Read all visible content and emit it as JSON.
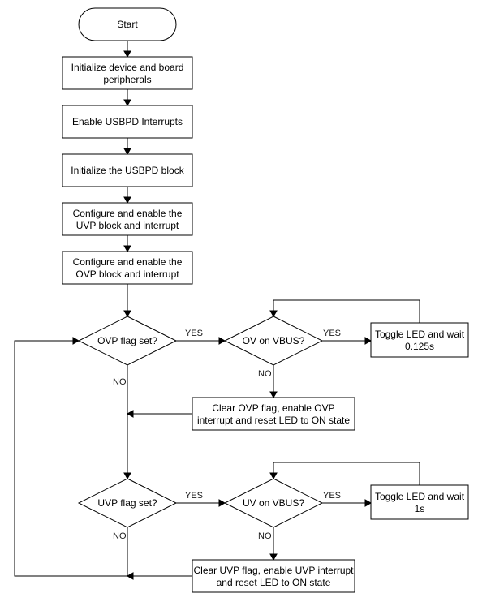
{
  "diagram": {
    "type": "flowchart",
    "nodes": {
      "start": {
        "kind": "terminator",
        "lines": [
          "Start"
        ]
      },
      "init_device": {
        "kind": "process",
        "lines": [
          "Initialize device and board",
          "peripherals"
        ]
      },
      "enable_irq": {
        "kind": "process",
        "lines": [
          "Enable USBPD Interrupts"
        ]
      },
      "init_usbpd": {
        "kind": "process",
        "lines": [
          "Initialize the USBPD block"
        ]
      },
      "cfg_uvp": {
        "kind": "process",
        "lines": [
          "Configure and enable the",
          "UVP block and interrupt"
        ]
      },
      "cfg_ovp": {
        "kind": "process",
        "lines": [
          "Configure and enable the",
          "OVP block and interrupt"
        ]
      },
      "ovp_flag": {
        "kind": "decision",
        "lines": [
          "OVP flag set?"
        ]
      },
      "ov_vbus": {
        "kind": "decision",
        "lines": [
          "OV on VBUS?"
        ]
      },
      "toggle_ov": {
        "kind": "process",
        "lines": [
          "Toggle LED and wait",
          "0.125s"
        ]
      },
      "clear_ovp": {
        "kind": "process",
        "lines": [
          "Clear OVP flag, enable OVP",
          "interrupt and reset LED to ON state"
        ]
      },
      "uvp_flag": {
        "kind": "decision",
        "lines": [
          "UVP flag set?"
        ]
      },
      "uv_vbus": {
        "kind": "decision",
        "lines": [
          "UV on VBUS?"
        ]
      },
      "toggle_uv": {
        "kind": "process",
        "lines": [
          "Toggle LED and wait",
          "1s"
        ]
      },
      "clear_uvp": {
        "kind": "process",
        "lines": [
          "Clear UVP flag, enable UVP interrupt",
          "and reset LED to ON state"
        ]
      }
    },
    "edge_labels": {
      "ovp_yes": "YES",
      "ovp_no": "NO",
      "ov_yes": "YES",
      "ov_no": "NO",
      "uvp_yes": "YES",
      "uvp_no": "NO",
      "uv_yes": "YES",
      "uv_no": "NO"
    },
    "edges": [
      [
        "start",
        "init_device"
      ],
      [
        "init_device",
        "enable_irq"
      ],
      [
        "enable_irq",
        "init_usbpd"
      ],
      [
        "init_usbpd",
        "cfg_uvp"
      ],
      [
        "cfg_uvp",
        "cfg_ovp"
      ],
      [
        "cfg_ovp",
        "ovp_flag"
      ],
      [
        "ovp_flag",
        "ov_vbus",
        "YES"
      ],
      [
        "ovp_flag",
        "uvp_flag",
        "NO"
      ],
      [
        "ov_vbus",
        "toggle_ov",
        "YES"
      ],
      [
        "toggle_ov",
        "ov_vbus"
      ],
      [
        "ov_vbus",
        "clear_ovp",
        "NO"
      ],
      [
        "clear_ovp",
        "uvp_flag"
      ],
      [
        "uvp_flag",
        "uv_vbus",
        "YES"
      ],
      [
        "uvp_flag",
        "ovp_flag",
        "NO"
      ],
      [
        "uv_vbus",
        "toggle_uv",
        "YES"
      ],
      [
        "toggle_uv",
        "uv_vbus"
      ],
      [
        "uv_vbus",
        "clear_uvp",
        "NO"
      ],
      [
        "clear_uvp",
        "ovp_flag"
      ]
    ]
  }
}
